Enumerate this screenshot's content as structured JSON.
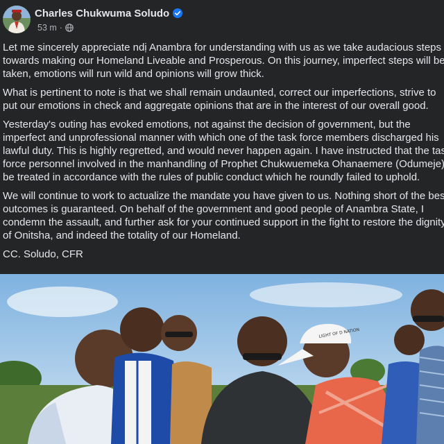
{
  "post": {
    "author": "Charles Chukwuma Soludo",
    "time": "53 m",
    "separator": "·",
    "audience_icon": "globe-icon",
    "verified_icon": "verified-badge-icon",
    "paragraphs": [
      [
        "Let me sincerely appreciate ndị Anambra for understanding with us as we take audacious steps",
        "towards making our Homeland Liveable and Prosperous. On this journey, imperfect steps will be",
        "taken, emotions will run wild and opinions will grow thick."
      ],
      [
        "What is pertinent to note is that we shall remain undaunted, correct our imperfections, strive to",
        "put our emotions in check and aggregate opinions that are in the interest of our overall good."
      ],
      [
        "Yesterday's outing has evoked emotions, not against the decision of government, but the",
        "imperfect and unprofessional manner with which one of the task force members discharged his",
        "lawful duty. This is highly regretted, and would never happen again. I have instructed that the task",
        "force personnel involved in the manhandling of Prophet Chukwuemeka Ohanaemere (Odumeje)",
        "be treated in accordance with the rules of public conduct which he roundly failed to uphold."
      ],
      [
        "We will continue to work to actualize the mandate you have given to us. Nothing short of the best",
        "outcomes is guaranteed. On behalf of the government and good people of Anambra State, I",
        "condemn the assault, and further ask for your continued support in the fight to restore the dignity",
        "of Onitsha, and indeed the totality of our Homeland."
      ],
      [
        "CC. Soludo, CFR"
      ]
    ],
    "photo": {
      "cap_text": "LIGHT OF D NATION"
    }
  },
  "colors": {
    "background": "#242526",
    "primary_text": "#e4e6eb",
    "secondary_text": "#b0b3b8",
    "verified_blue": "#1877f2"
  }
}
